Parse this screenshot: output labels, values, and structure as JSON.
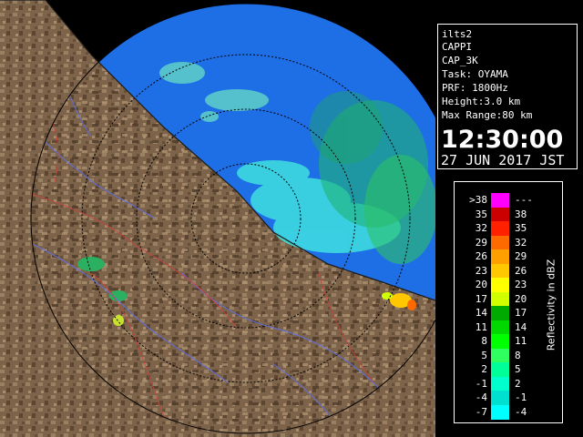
{
  "info": {
    "station": "ilts2",
    "product": "CAPPI",
    "product_name": "CAP_3K",
    "task": "Task: OYAMA",
    "prf": "PRF: 1800Hz",
    "height": "Height:3.0 km",
    "max_range": "Max Range:80 km",
    "time": "12:30:00",
    "date": "27 JUN 2017 JST"
  },
  "legend": {
    "title": "Reflectivity in dBZ",
    "rows": [
      {
        "lo": ">38",
        "hi": "---",
        "color": "#ff00ff"
      },
      {
        "lo": "35",
        "hi": "38",
        "color": "#cc0000"
      },
      {
        "lo": "32",
        "hi": "35",
        "color": "#ff2000"
      },
      {
        "lo": "29",
        "hi": "32",
        "color": "#ff6a00"
      },
      {
        "lo": "26",
        "hi": "29",
        "color": "#ffa000"
      },
      {
        "lo": "23",
        "hi": "26",
        "color": "#ffc800"
      },
      {
        "lo": "20",
        "hi": "23",
        "color": "#ffff00"
      },
      {
        "lo": "17",
        "hi": "20",
        "color": "#d2ff00"
      },
      {
        "lo": "14",
        "hi": "17",
        "color": "#00aa00"
      },
      {
        "lo": "11",
        "hi": "14",
        "color": "#00d800"
      },
      {
        "lo": "8",
        "hi": "11",
        "color": "#00ff00"
      },
      {
        "lo": "5",
        "hi": "8",
        "color": "#30ff60"
      },
      {
        "lo": "2",
        "hi": "5",
        "color": "#00ff99"
      },
      {
        "lo": "-1",
        "hi": "2",
        "color": "#00ffcc"
      },
      {
        "lo": "-4",
        "hi": "-1",
        "color": "#00e0d0"
      },
      {
        "lo": "-7",
        "hi": "-4",
        "color": "#00ffff"
      }
    ]
  },
  "map": {
    "land_color": "#7a6248",
    "sea_color": "#1e6ee6",
    "outside_color": "#000000"
  }
}
